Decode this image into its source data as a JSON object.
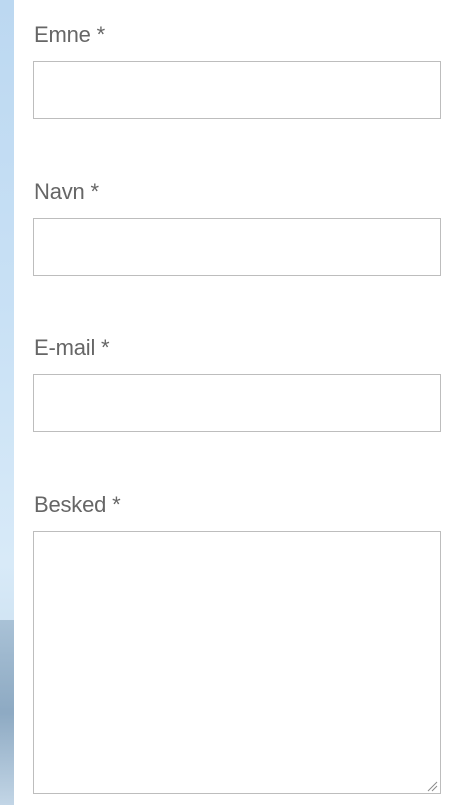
{
  "form": {
    "fields": [
      {
        "label": "Emne *",
        "value": "",
        "type": "text"
      },
      {
        "label": "Navn *",
        "value": "",
        "type": "text"
      },
      {
        "label": "E-mail *",
        "value": "",
        "type": "email"
      },
      {
        "label": "Besked *",
        "value": "",
        "type": "textarea"
      }
    ]
  },
  "icons": {
    "textarea_resize": "resize-grip-icon"
  },
  "colors": {
    "label": "#666666",
    "border": "#bdbdbd",
    "panel_bg": "#ffffff",
    "page_bg": "#c9e1f5"
  }
}
